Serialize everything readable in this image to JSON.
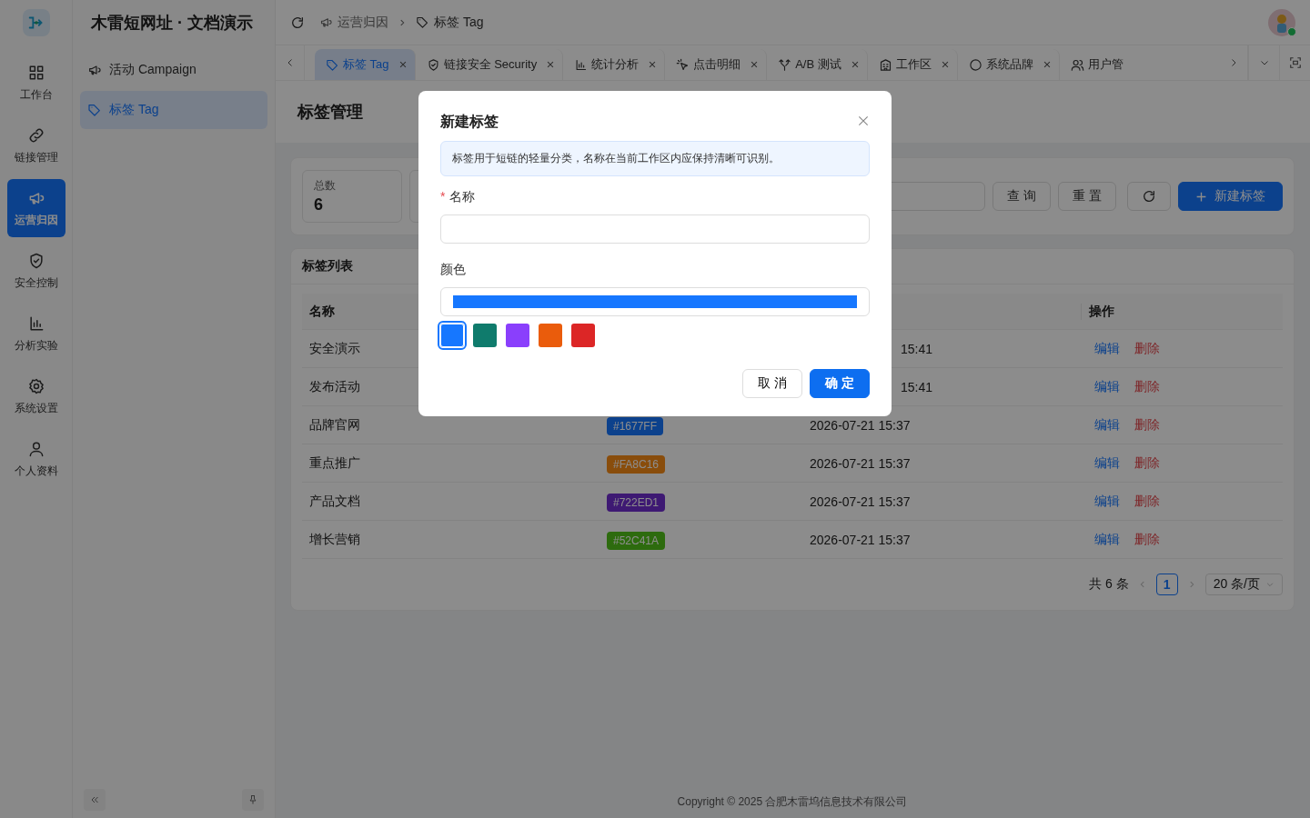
{
  "app": {
    "title": "木雷短网址 · 文档演示"
  },
  "rail": [
    {
      "label": "工作台",
      "selected": false
    },
    {
      "label": "链接管理",
      "selected": false
    },
    {
      "label": "运营归因",
      "selected": true
    },
    {
      "label": "安全控制",
      "selected": false
    },
    {
      "label": "分析实验",
      "selected": false
    },
    {
      "label": "系统设置",
      "selected": false
    },
    {
      "label": "个人资料",
      "selected": false
    }
  ],
  "submenu": [
    {
      "label": "活动 Campaign",
      "selected": false
    },
    {
      "label": "标签 Tag",
      "selected": true
    }
  ],
  "breadcrumb": [
    "运营归因",
    "标签 Tag"
  ],
  "user": {
    "online": true
  },
  "tabs": [
    {
      "label": "标签 Tag",
      "selected": true
    },
    {
      "label": "链接安全 Security",
      "selected": false
    },
    {
      "label": "统计分析",
      "selected": false
    },
    {
      "label": "点击明细",
      "selected": false
    },
    {
      "label": "A/B 测试",
      "selected": false
    },
    {
      "label": "工作区",
      "selected": false
    },
    {
      "label": "系统品牌",
      "selected": false
    },
    {
      "label": "用户管",
      "selected": false
    }
  ],
  "page": {
    "title": "标签管理"
  },
  "stats": [
    {
      "label": "总数",
      "value": "6"
    }
  ],
  "filter_buttons": [
    {
      "kind": "text",
      "label": "查 询"
    },
    {
      "kind": "text",
      "label": "重 置"
    },
    {
      "kind": "refresh"
    },
    {
      "kind": "primary",
      "label": "新建标签"
    }
  ],
  "table": {
    "title": "标签列表",
    "columns": [
      "名称",
      "操作"
    ],
    "rows": [
      {
        "name": "安全演示",
        "created": "15:41",
        "actions": [
          "编辑",
          "删除"
        ]
      },
      {
        "name": "发布活动",
        "created": "15:41",
        "actions": [
          "编辑",
          "删除"
        ]
      },
      {
        "name": "品牌官网",
        "color_tag": "#1677FF",
        "created": "2026-07-21 15:37",
        "actions": [
          "编辑",
          "删除"
        ]
      },
      {
        "name": "重点推广",
        "color_tag": "#FA8C16",
        "created": "2026-07-21 15:37",
        "actions": [
          "编辑",
          "删除"
        ]
      },
      {
        "name": "产品文档",
        "color_tag": "#722ED1",
        "created": "2026-07-21 15:37",
        "actions": [
          "编辑",
          "删除"
        ]
      },
      {
        "name": "增长营销",
        "color_tag": "#52C41A",
        "created": "2026-07-21 15:37",
        "actions": [
          "编辑",
          "删除"
        ]
      }
    ],
    "pagination": {
      "total": "共 6 条",
      "page": "1",
      "page_size": "20 条/页"
    }
  },
  "footer": "Copyright © 2025 合肥木雷坞信息技术有限公司",
  "modal": {
    "title": "新建标签",
    "info": "标签用于短链的轻量分类，名称在当前工作区内应保持清晰可识别。",
    "fields": [
      {
        "label": "名称",
        "required_mark": "*"
      },
      {
        "label": "颜色",
        "color": "#1677ff"
      }
    ],
    "swatches": [
      {
        "color": "#1677ff",
        "selected": true
      },
      {
        "color": "#0f7b6c",
        "selected": false
      },
      {
        "color": "#8a3ffc",
        "selected": false
      },
      {
        "color": "#ea5c0c",
        "selected": false
      },
      {
        "color": "#dc2626",
        "selected": false
      }
    ],
    "buttons": [
      {
        "kind": "default",
        "label": "取 消"
      },
      {
        "kind": "primary",
        "label": "确 定"
      }
    ]
  }
}
